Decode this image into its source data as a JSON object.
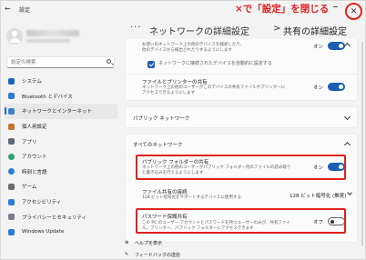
{
  "titlebar": {
    "app_title": "設定",
    "annotation": "×で「設定」を閉じる",
    "close_glyph": "✕",
    "back_glyph": "←"
  },
  "sidebar": {
    "search_placeholder": "設定の検索",
    "items": [
      {
        "label": "システム",
        "icon": "monitor-icon",
        "color": "#1a66c3",
        "active": false
      },
      {
        "label": "Bluetooth とデバイス",
        "icon": "bluetooth-icon",
        "color": "#2a7bd6",
        "active": false
      },
      {
        "label": "ネットワークとインターネット",
        "icon": "wifi-icon",
        "color": "#3a7fc8",
        "active": true
      },
      {
        "label": "個人用設定",
        "icon": "brush-icon",
        "color": "#c8742a",
        "active": false
      },
      {
        "label": "アプリ",
        "icon": "apps-icon",
        "color": "#5a6a7a",
        "active": false
      },
      {
        "label": "アカウント",
        "icon": "account-icon",
        "color": "#2fa36b",
        "active": false
      },
      {
        "label": "時刻と言語",
        "icon": "clock-globe-icon",
        "color": "#2a7bd6",
        "active": false
      },
      {
        "label": "ゲーム",
        "icon": "controller-icon",
        "color": "#6a6a6a",
        "active": false
      },
      {
        "label": "アクセシビリティ",
        "icon": "accessibility-icon",
        "color": "#2a7bd6",
        "active": false
      },
      {
        "label": "プライバシーとセキュリティ",
        "icon": "shield-icon",
        "color": "#7a7a8a",
        "active": false
      },
      {
        "label": "Windows Update",
        "icon": "update-icon",
        "color": "#2a7bd6",
        "active": false
      }
    ]
  },
  "header": {
    "dots": "···",
    "crumb1": "ネットワークの詳細設定",
    "separator": ">",
    "crumb2": "共有の詳細設定"
  },
  "content": {
    "top_row": {
      "desc1": "お使いのネットワーク上の他のデバイスを検索したり、",
      "desc2": "他のデバイスから検出されたりするようにします",
      "toggle_label": "オン"
    },
    "auto_connect_label": "ネットワークに接続されたデバイスを自動的に設定する",
    "file_printer": {
      "title": "ファイルとプリンターの共有",
      "desc1": "ネットワーク上の他のユーザーがこのデバイスの共有ファイルやプリンターに",
      "desc2": "アクセスできるようにします",
      "toggle_label": "オン"
    },
    "public_network": "パブリック ネットワーク",
    "all_networks": "すべてのネットワーク",
    "public_folder": {
      "title": "パブリック フォルダーの共有",
      "desc1": "ネットワーク上の他のユーザーがパブリック フォルダー内のファイルの読み取り",
      "desc2": "と書き込みを行えるようにします",
      "toggle_label": "オン"
    },
    "encryption": {
      "title": "ファイル共有の接続",
      "desc": "128 ビット暗号化をサポートするデバイスに使用する",
      "value": "128 ビット暗号化 (推奨)"
    },
    "password": {
      "title": "パスワード保護共有",
      "desc1": "この PC のユーザー アカウントとパスワードを持つユーザーのみが、共有ファイ",
      "desc2": "ル、プリンター、パブリック フォルダーにアクセスできます",
      "toggle_label": "オフ"
    },
    "help_label": "ヘルプを表示",
    "feedback_label": "フィードバックの送信"
  },
  "colors": {
    "accent": "#1a5fb4",
    "annotation_red": "#e0201c"
  }
}
